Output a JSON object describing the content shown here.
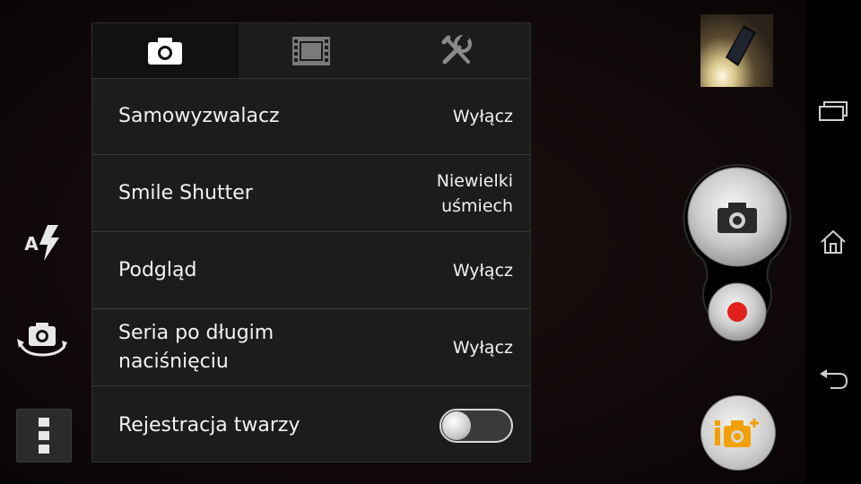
{
  "settings": {
    "tabs": [
      {
        "icon": "camera-icon",
        "active": true
      },
      {
        "icon": "film-strip-icon",
        "active": false
      },
      {
        "icon": "tools-icon",
        "active": false
      }
    ],
    "rows": [
      {
        "label": "Samowyzwalacz",
        "value": "Wyłącz"
      },
      {
        "label": "Smile Shutter",
        "value_line1": "Niewielki",
        "value_line2": "uśmiech"
      },
      {
        "label": "Podgląd",
        "value": "Wyłącz"
      },
      {
        "label": "Seria po długim naciśnięciu",
        "value": "Wyłącz"
      },
      {
        "label": "Rejestracja twarzy",
        "toggle_on": false
      }
    ]
  },
  "left_controls": {
    "flash_mode_text": "A",
    "icons": [
      "flash-auto-icon",
      "switch-camera-icon",
      "menu-icon"
    ]
  },
  "right_controls": {
    "icons": [
      "gallery-thumbnail",
      "shutter-camera-icon",
      "record-icon",
      "info-eye-icon"
    ],
    "record_color": "#e0201a",
    "badge_accent": "#f2a000"
  },
  "navbar": {
    "icons": [
      "recent-apps-icon",
      "home-icon",
      "back-icon"
    ]
  }
}
